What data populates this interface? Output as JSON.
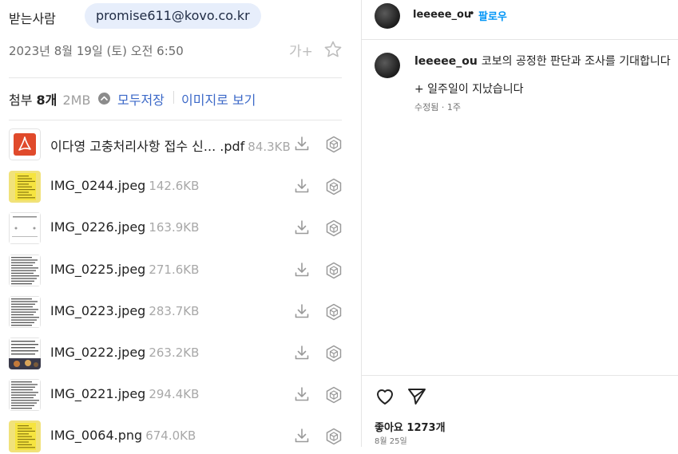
{
  "mail": {
    "recipient_label": "받는사람",
    "recipient_email": "promise611@kovo.co.kr",
    "date": "2023년 8월 19일 (토) 오전 6:50",
    "font_size_icon": "가+",
    "attachments_label": "첨부",
    "attachments_count": "8개",
    "attachments_size": "2MB",
    "save_all": "모두저장",
    "view_as_images": "이미지로 보기",
    "files": [
      {
        "name": "이다영 고충처리사항 접수 신... .pdf",
        "size": "84.3KB",
        "thumb": "pdf"
      },
      {
        "name": "IMG_0244.jpeg",
        "size": "142.6KB",
        "thumb": "yellow-doc"
      },
      {
        "name": "IMG_0226.jpeg",
        "size": "163.9KB",
        "thumb": "white-doc"
      },
      {
        "name": "IMG_0225.jpeg",
        "size": "271.6KB",
        "thumb": "text-doc"
      },
      {
        "name": "IMG_0223.jpeg",
        "size": "283.7KB",
        "thumb": "text-doc"
      },
      {
        "name": "IMG_0222.jpeg",
        "size": "263.2KB",
        "thumb": "photo-doc"
      },
      {
        "name": "IMG_0221.jpeg",
        "size": "294.4KB",
        "thumb": "text-doc"
      },
      {
        "name": "IMG_0064.png",
        "size": "674.0KB",
        "thumb": "yellow-doc"
      }
    ]
  },
  "post": {
    "username": "leeeee_ou",
    "follow": "팔로우",
    "separator": "•",
    "comment_user": "leeeee_ou",
    "comment_text": "코보의 공정한 판단과 조사를 기대합니다",
    "comment_line2": "+ 일주일이 지났습니다",
    "comment_meta": "수정됨 · 1주",
    "likes": "좋아요 1273개",
    "date": "8월 25일"
  },
  "colors": {
    "link": "#3c69c8",
    "follow": "#0095f6",
    "chip_bg": "#e7eefb",
    "pdf_red": "#e04a2b"
  }
}
